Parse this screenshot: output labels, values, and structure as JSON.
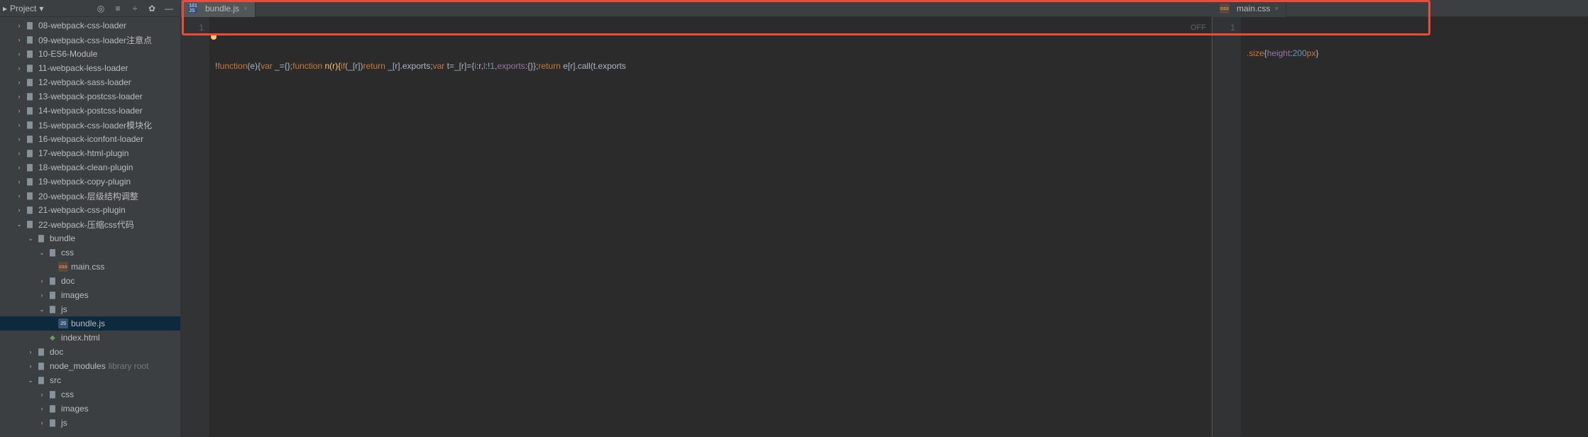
{
  "sidebar": {
    "title": "Project",
    "items": [
      {
        "label": "08-webpack-css-loader",
        "depth": 1,
        "chev": "right",
        "icon": "folder"
      },
      {
        "label": "09-webpack-css-loader注意点",
        "depth": 1,
        "chev": "right",
        "icon": "folder"
      },
      {
        "label": "10-ES6-Module",
        "depth": 1,
        "chev": "right",
        "icon": "folder"
      },
      {
        "label": "11-webpack-less-loader",
        "depth": 1,
        "chev": "right",
        "icon": "folder"
      },
      {
        "label": "12-webpack-sass-loader",
        "depth": 1,
        "chev": "right",
        "icon": "folder"
      },
      {
        "label": "13-webpack-postcss-loader",
        "depth": 1,
        "chev": "right",
        "icon": "folder"
      },
      {
        "label": "14-webpack-postcss-loader",
        "depth": 1,
        "chev": "right",
        "icon": "folder"
      },
      {
        "label": "15-webpack-css-loader模块化",
        "depth": 1,
        "chev": "right",
        "icon": "folder"
      },
      {
        "label": "16-webpack-iconfont-loader",
        "depth": 1,
        "chev": "right",
        "icon": "folder"
      },
      {
        "label": "17-webpack-html-plugin",
        "depth": 1,
        "chev": "right",
        "icon": "folder"
      },
      {
        "label": "18-webpack-clean-plugin",
        "depth": 1,
        "chev": "right",
        "icon": "folder"
      },
      {
        "label": "19-webpack-copy-plugin",
        "depth": 1,
        "chev": "right",
        "icon": "folder"
      },
      {
        "label": "20-webpack-层级结构调整",
        "depth": 1,
        "chev": "right",
        "icon": "folder"
      },
      {
        "label": "21-webpack-css-plugin",
        "depth": 1,
        "chev": "right",
        "icon": "folder"
      },
      {
        "label": "22-webpack-压缩css代码",
        "depth": 1,
        "chev": "down",
        "icon": "folder"
      },
      {
        "label": "bundle",
        "depth": 2,
        "chev": "down",
        "icon": "folder"
      },
      {
        "label": "css",
        "depth": 3,
        "chev": "down",
        "icon": "folder"
      },
      {
        "label": "main.css",
        "depth": 4,
        "chev": "",
        "icon": "css"
      },
      {
        "label": "doc",
        "depth": 3,
        "chev": "right",
        "icon": "folder"
      },
      {
        "label": "images",
        "depth": 3,
        "chev": "right",
        "icon": "folder"
      },
      {
        "label": "js",
        "depth": 3,
        "chev": "down",
        "icon": "folder"
      },
      {
        "label": "bundle.js",
        "depth": 4,
        "chev": "",
        "icon": "js",
        "selected": true
      },
      {
        "label": "index.html",
        "depth": 3,
        "chev": "",
        "icon": "html"
      },
      {
        "label": "doc",
        "depth": 2,
        "chev": "right",
        "icon": "folder"
      },
      {
        "label": "node_modules",
        "depth": 2,
        "chev": "right",
        "icon": "folder",
        "sublabel": "library root"
      },
      {
        "label": "src",
        "depth": 2,
        "chev": "down",
        "icon": "folder"
      },
      {
        "label": "css",
        "depth": 3,
        "chev": "right",
        "icon": "folder"
      },
      {
        "label": "images",
        "depth": 3,
        "chev": "right",
        "icon": "folder"
      },
      {
        "label": "js",
        "depth": 3,
        "chev": "right",
        "icon": "folder"
      }
    ]
  },
  "tabs": {
    "left": {
      "label": "bundle.js",
      "icon": "js"
    },
    "right": {
      "label": "main.css",
      "icon": "css"
    }
  },
  "editor_left": {
    "line_number": "1",
    "off_label": "OFF",
    "code_tokens": {
      "t1": "!",
      "t2": "function",
      "t3": "(e){",
      "t4": "var",
      "t5": " _={};",
      "t6": "function",
      "t7": " n(r){",
      "t8": "if",
      "t9": "(_[r])",
      "t10": "return",
      "t11": " _[r].exports;",
      "t12": "var",
      "t13": " t=_[r]={",
      "t14": "i",
      "t15": ":r,",
      "t16": "l",
      "t17": ":!",
      "t18": "1",
      "t19": ",",
      "t20": "exports",
      "t21": ":{}};",
      "t22": "return",
      "t23": " e[r].call(t.exports"
    }
  },
  "editor_right": {
    "line_number": "1",
    "code_tokens": {
      "t1": ".size",
      "t2": "{",
      "t3": "height",
      "t4": ":",
      "t5": "200",
      "t6": "px",
      "t7": "}"
    }
  }
}
